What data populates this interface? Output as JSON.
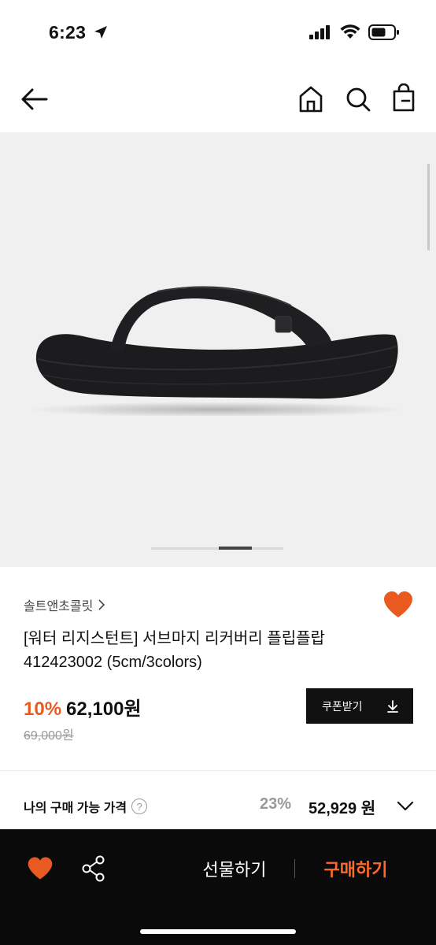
{
  "status": {
    "time": "6:23"
  },
  "nav": {
    "back_icon": "arrow-left-icon",
    "home_icon": "home-icon",
    "search_icon": "search-icon",
    "bag_icon": "shopping-bag-icon"
  },
  "gallery": {
    "image": "black platform flip-flop sandal",
    "current_page": 3,
    "total_pages": 4
  },
  "product": {
    "brand": "솔트앤초콜릿",
    "name_line1": "[워터 리지스턴트] 서브마지 리커버리 플립플랍",
    "name_line2": "412423002 (5cm/3colors)",
    "discount": "10%",
    "price": "62,100원",
    "original_price": "69,000원",
    "wishlisted": true
  },
  "coupon": {
    "label": "쿠폰받기"
  },
  "my_price": {
    "label": "나의 구매 가능 가격",
    "discount": "23%",
    "value": "52,929 원"
  },
  "bottom_bar": {
    "gift_label": "선물하기",
    "buy_label": "구매하기"
  },
  "colors": {
    "accent": "#e85a1f",
    "buy": "#ff6a2c",
    "dark": "#0a0a0a"
  }
}
